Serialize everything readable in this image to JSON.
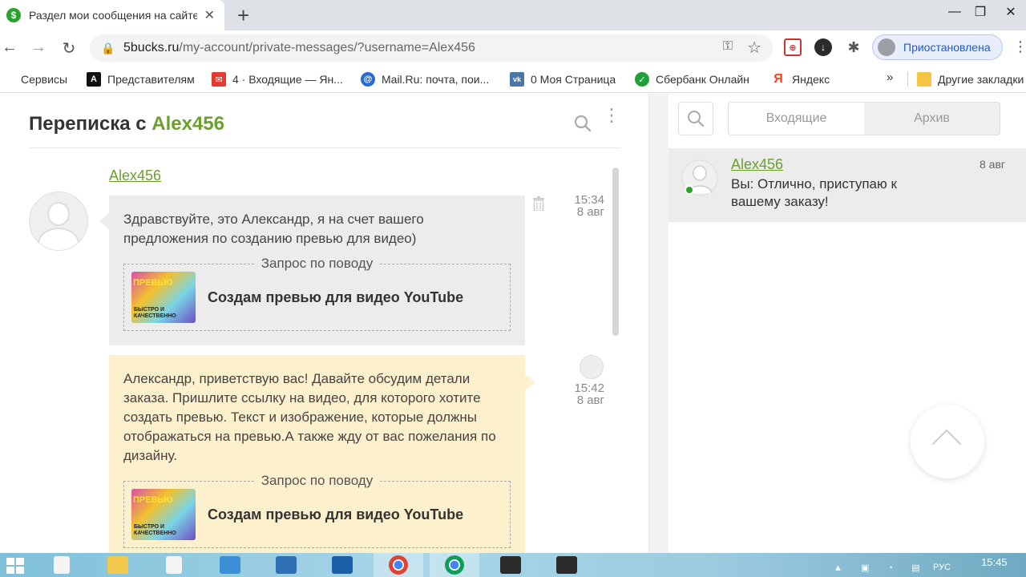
{
  "browser": {
    "tab_title": "Раздел мои сообщения на сайте",
    "tab_favicon": "$",
    "url_domain": "5bucks.ru",
    "url_path": "/my-account/private-messages/?username=Alex456",
    "profile_label": "Приостановлена",
    "ext1_label": "⊕"
  },
  "bookmarks": [
    {
      "label": "Сервисы",
      "icon": "apps-icon",
      "color": "#e94335"
    },
    {
      "label": "Представителям",
      "icon": "A",
      "color": "#111111"
    },
    {
      "label": "4 · Входящие — Ян...",
      "icon": "✉",
      "color": "#e43a2f"
    },
    {
      "label": "Mail.Ru: почта, пои...",
      "icon": "@",
      "color": "#2a6bd1"
    },
    {
      "label": "0 Моя Страница",
      "icon": "vk",
      "color": "#4a76a8"
    },
    {
      "label": "Сбербанк Онлайн",
      "icon": "S",
      "color": "#21a038"
    },
    {
      "label": "Яндекс",
      "icon": "Я",
      "color": "#fc3f1d"
    },
    {
      "label": "Другие закладки",
      "icon": "folder-icon",
      "color": "#f4c542"
    }
  ],
  "bookmarks_more": "»",
  "conversation": {
    "title_prefix": "Переписка с ",
    "username": "Alex456"
  },
  "messages": [
    {
      "author": "Alex456",
      "text": "Здравствуйте, это Александр, я на счет вашего предложения по созданию превью для видео)",
      "request_legend": "Запрос по поводу",
      "request_title": "Создам превью для видео YouTube",
      "thumb_top": "ПРЕВЬЮ",
      "thumb_bottom": "БЫСТРО И КАЧЕСТВЕННО",
      "time": "15:34",
      "date": "8 авг"
    },
    {
      "author": "me",
      "text": "Александр, приветствую вас! Давайте обсудим детали заказа. Пришлите ссылку на видео, для которого хотите создать превью. Текст и изображение, которые должны отображаться на превью.А также жду от вас пожелания по дизайну.",
      "request_legend": "Запрос по поводу",
      "request_title": "Создам превью для видео YouTube",
      "thumb_top": "ПРЕВЬЮ",
      "thumb_bottom": "БЫСТРО И КАЧЕСТВЕННО",
      "time": "15:42",
      "date": "8 авг"
    }
  ],
  "sidebar": {
    "tabs": [
      {
        "label": "Входящие",
        "active": true
      },
      {
        "label": "Архив",
        "active": false
      }
    ],
    "conversations": [
      {
        "name": "Alex456",
        "date": "8 авг",
        "preview": "Вы: Отлично, приступаю к вашему заказу!",
        "online": true
      }
    ]
  },
  "taskbar": {
    "clock": "15:45",
    "lang": "РУС"
  },
  "colors": {
    "accent_green": "#6ba02c",
    "incoming_bubble": "#ececec",
    "outgoing_bubble": "#fcf0cd"
  }
}
